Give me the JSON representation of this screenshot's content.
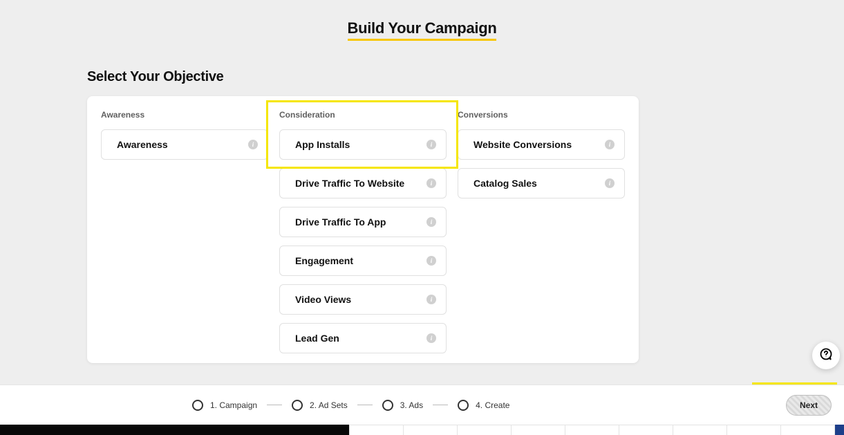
{
  "header": {
    "title": "Build Your Campaign"
  },
  "section": {
    "title": "Select Your Objective"
  },
  "columns": {
    "awareness": {
      "header": "Awareness",
      "items": [
        {
          "label": "Awareness"
        }
      ]
    },
    "consideration": {
      "header": "Consideration",
      "items": [
        {
          "label": "App Installs"
        },
        {
          "label": "Drive Traffic To Website"
        },
        {
          "label": "Drive Traffic To App"
        },
        {
          "label": "Engagement"
        },
        {
          "label": "Video Views"
        },
        {
          "label": "Lead Gen"
        }
      ]
    },
    "conversions": {
      "header": "Conversions",
      "items": [
        {
          "label": "Website Conversions"
        },
        {
          "label": "Catalog Sales"
        }
      ]
    }
  },
  "stepper": {
    "steps": [
      {
        "label": "1. Campaign"
      },
      {
        "label": "2. Ad Sets"
      },
      {
        "label": "3. Ads"
      },
      {
        "label": "4. Create"
      }
    ],
    "next_label": "Next"
  }
}
